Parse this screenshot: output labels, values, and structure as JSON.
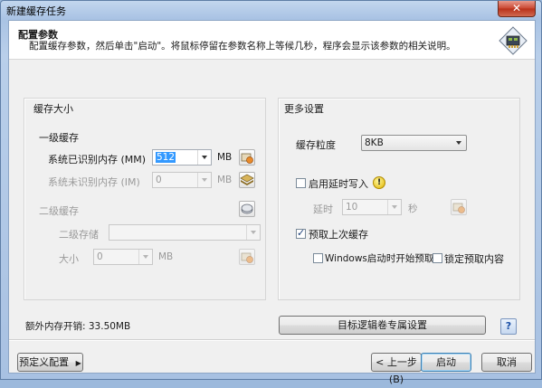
{
  "window": {
    "title": "新建缓存任务",
    "close_label": "✕"
  },
  "header": {
    "title": "配置参数",
    "description": "配置缓存参数，然后单击\"启动\"。将鼠标停留在参数名称上等候几秒，程序会显示该参数的相关说明。"
  },
  "cache_size": {
    "title": "缓存大小",
    "level1": {
      "title": "一级缓存",
      "recognized_label": "系统已识别内存 (MM)",
      "recognized_value": "512",
      "recognized_unit": "MB",
      "unrecognized_label": "系统未识别内存 (IM)",
      "unrecognized_value": "0",
      "unrecognized_unit": "MB"
    },
    "level2": {
      "title": "二级缓存",
      "storage_label": "二级存储",
      "storage_value": "",
      "size_label": "大小",
      "size_value": "0",
      "size_unit": "MB"
    }
  },
  "more_settings": {
    "title": "更多设置",
    "granularity_label": "缓存粒度",
    "granularity_value": "8KB",
    "delayed_write_label": "启用延时写入",
    "delayed_write_checked": false,
    "delay_label": "延时",
    "delay_value": "10",
    "delay_unit": "秒",
    "prefetch_label": "预取上次缓存",
    "prefetch_checked": true,
    "prefetch_on_boot_label": "Windows启动时开始预取",
    "prefetch_on_boot_checked": false,
    "lock_prefetch_label": "锁定预取内容",
    "lock_prefetch_checked": false
  },
  "extra_memory_text": "额外内存开销: 33.50MB",
  "target_volume_button": "目标逻辑卷专属设置",
  "help_label": "?",
  "footer": {
    "preset_button": "预定义配置",
    "back_button": "< 上一步(B)",
    "start_button": "启动",
    "cancel_button": "取消"
  },
  "colors": {
    "titlebar": "#a9c3e4",
    "close": "#c9452f",
    "dialog_bg": "#f0f0f0",
    "selection": "#3399ff"
  }
}
